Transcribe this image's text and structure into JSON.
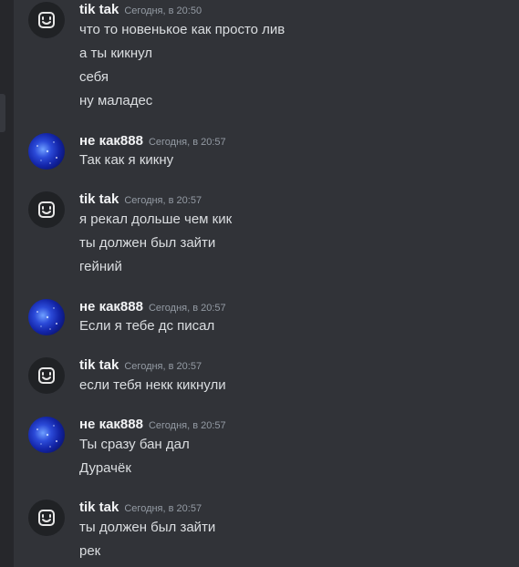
{
  "groups": [
    {
      "author": "tik tak",
      "timestamp": "Сегодня, в 20:50",
      "avatar": "bot-face-icon",
      "lines": [
        "что то новенькое как просто лив",
        "а ты кикнул",
        "себя",
        "ну маладес"
      ]
    },
    {
      "author": "не как888",
      "timestamp": "Сегодня, в 20:57",
      "avatar": "space-avatar",
      "lines": [
        "Так как я кикну"
      ]
    },
    {
      "author": "tik tak",
      "timestamp": "Сегодня, в 20:57",
      "avatar": "bot-face-icon",
      "lines": [
        "я рекал дольше чем кик",
        "ты должен был зайти",
        "гейний"
      ]
    },
    {
      "author": "не как888",
      "timestamp": "Сегодня, в 20:57",
      "avatar": "space-avatar",
      "lines": [
        "Если я тебе дс писал"
      ]
    },
    {
      "author": "tik tak",
      "timestamp": "Сегодня, в 20:57",
      "avatar": "bot-face-icon",
      "lines": [
        "если тебя некк кикнули"
      ]
    },
    {
      "author": "не как888",
      "timestamp": "Сегодня, в 20:57",
      "avatar": "space-avatar",
      "lines": [
        "Ты сразу бан дал",
        "Дурачёк"
      ]
    },
    {
      "author": "tik tak",
      "timestamp": "Сегодня, в 20:57",
      "avatar": "bot-face-icon",
      "lines": [
        "ты должен был зайти",
        "рек"
      ]
    }
  ],
  "colors": {
    "chat_bg": "#313338",
    "username": "#f2f3f5",
    "timestamp": "#949ba4",
    "message_text": "#dbdee1"
  }
}
